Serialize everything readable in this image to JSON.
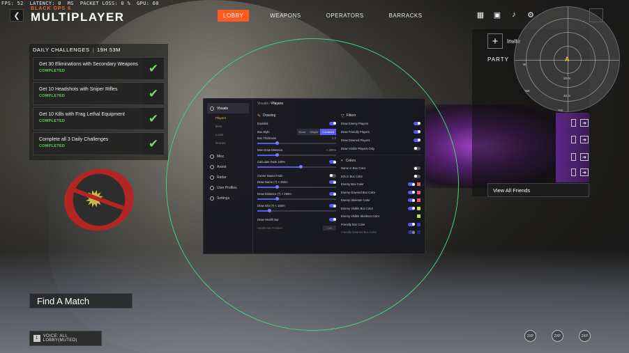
{
  "hud": {
    "stats": "FPS: 52  LATENCY: 0  MS  PACKET LOSS: 0 %  GPU: 60"
  },
  "brand": {
    "game": "BLACK OPS 6",
    "mode": "MULTIPLAYER"
  },
  "nav": {
    "back_glyph": "❮",
    "tabs": [
      {
        "label": "LOBBY",
        "active": true
      },
      {
        "label": "WEAPONS",
        "active": false
      },
      {
        "label": "OPERATORS",
        "active": false
      },
      {
        "label": "BARRACKS",
        "active": false
      }
    ],
    "icons": [
      "grid-icon",
      "store-icon",
      "bell-icon",
      "gear-icon"
    ]
  },
  "challenges": {
    "title": "DAILY CHALLENGES",
    "timer": "19H 53M",
    "items": [
      {
        "text": "Get 30 Eliminations with Secondary Weapons",
        "status": "COMPLETED"
      },
      {
        "text": "Get 10 Headshots with Sniper Rifles",
        "status": "COMPLETED"
      },
      {
        "text": "Get 10 Kills with Frag Lethal Equipment",
        "status": "COMPLETED"
      },
      {
        "text": "Complete all 3 Daily Challenges",
        "status": "COMPLETED"
      }
    ],
    "check_glyph": "✔"
  },
  "find_match": "Find A Match",
  "voice": {
    "key": "1",
    "label": "VOICE: ALL LOBBY(MUTED)"
  },
  "menu": {
    "crumb_parent": "Visuals",
    "crumb_current": "Players",
    "sidebar": [
      {
        "label": "Visuals",
        "active": true
      },
      {
        "label": "Players",
        "sub": true,
        "active": true
      },
      {
        "label": "Bots",
        "sub": true
      },
      {
        "label": "Loots",
        "sub": true
      },
      {
        "label": "Drones",
        "sub": true
      },
      {
        "label": "Misc"
      },
      {
        "label": "Assist"
      },
      {
        "label": "Radar"
      },
      {
        "label": "User Profiles"
      },
      {
        "label": "Settings"
      }
    ],
    "drawing": {
      "title": "Drawing",
      "enabled_label": "Enabled",
      "box_style_label": "Box Style",
      "box_style_options": [
        "None",
        "Simple",
        "Cornered"
      ],
      "box_style_selected": "Cornered",
      "box_thickness_label": "Box Thickness",
      "box_thickness_value": "2.0",
      "box_thickness_fraction": 0.25,
      "max_draw_label": "Max Draw Distance",
      "max_draw_value": "< 300m",
      "max_draw_fraction": 0.25,
      "fade_label": "Calculate Fade",
      "fade_value": "100%",
      "fade_fraction": 0.55,
      "corner_fade_label": "Corner Based Fade",
      "draw_name_label": "Draw Name",
      "draw_name_value": "< 250m",
      "draw_name_fraction": 0.25,
      "draw_distance_label": "Draw Distance",
      "draw_distance_value": "< 250m",
      "draw_distance_fraction": 0.25,
      "draw_info_label": "Draw Info",
      "draw_info_value": "< 150m",
      "draw_info_fraction": 0.15,
      "health_bar_label": "Draw Health Bar",
      "health_pos_label": "Health Bar Position",
      "health_pos_value": "Left"
    },
    "filters": {
      "title": "Filters",
      "items": [
        {
          "label": "Draw Enemy Players",
          "on": true
        },
        {
          "label": "Draw Friendly Players",
          "on": true
        },
        {
          "label": "Draw Downed Players",
          "on": true
        },
        {
          "label": "Draw Visible Players Only",
          "on": false
        }
      ]
    },
    "colors": {
      "title": "Colors",
      "items": [
        {
          "label": "Name in Box Color",
          "on": false,
          "swatch": ""
        },
        {
          "label": "Info in Box Color",
          "on": false,
          "swatch": ""
        },
        {
          "label": "Enemy Box Color",
          "on": true,
          "swatch": "#e8596a"
        },
        {
          "label": "Enemy Downed Box Color",
          "on": true,
          "swatch": "#e8596a"
        },
        {
          "label": "Enemy Skeleton Color",
          "on": true,
          "swatch": "#e8596a"
        },
        {
          "label": "Enemy Visible Box Color",
          "on": true,
          "swatch": "#b9e23a"
        },
        {
          "label": "Enemy Visible Skeleton Color",
          "on": false,
          "swatch": "#b9e23a"
        },
        {
          "label": "Friendly Box Color",
          "on": true,
          "swatch": "#3a3ac4"
        },
        {
          "label": "Friendly Downed Box Color",
          "on": true,
          "swatch": "#3a3ac4"
        }
      ]
    }
  },
  "party": {
    "invite": "Invite",
    "label": "PARTY",
    "view_friends": "View All Friends",
    "friend_btn_glyph": "➜"
  },
  "minimap": {
    "marker": "A",
    "ring_labels": [
      "20 m",
      "40 m"
    ],
    "compass": [
      "NW",
      "W",
      "SW"
    ]
  },
  "controller": [
    "2XP",
    "2XP",
    "2XP"
  ]
}
